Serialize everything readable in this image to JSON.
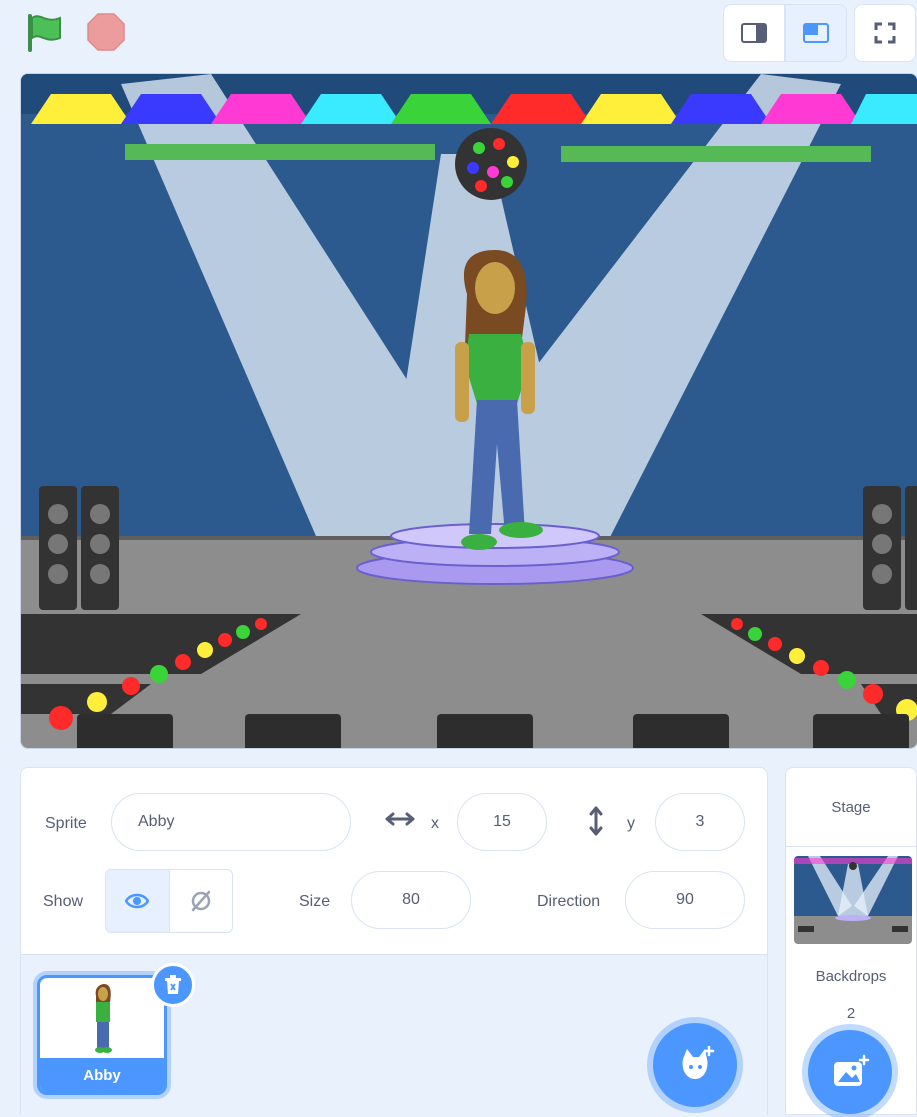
{
  "toolbar": {
    "green_flag_icon": "green-flag-icon",
    "stop_icon": "stop-icon",
    "small_stage_icon": "small-stage-icon",
    "large_stage_icon": "large-stage-icon",
    "fullscreen_icon": "fullscreen-icon"
  },
  "sprite_info": {
    "sprite_label": "Sprite",
    "sprite_name": "Abby",
    "x_label": "x",
    "x_value": "15",
    "y_label": "y",
    "y_value": "3",
    "show_label": "Show",
    "size_label": "Size",
    "size_value": "80",
    "direction_label": "Direction",
    "direction_value": "90"
  },
  "sprites": [
    {
      "name": "Abby",
      "selected": true
    }
  ],
  "stage_pane": {
    "title": "Stage",
    "backdrops_label": "Backdrops",
    "backdrops_count": "2"
  },
  "colors": {
    "accent": "#4c97ff",
    "green_flag": "#4cbf56",
    "stop": "#ec9c9c",
    "panel_bg": "#e9f1fc"
  }
}
